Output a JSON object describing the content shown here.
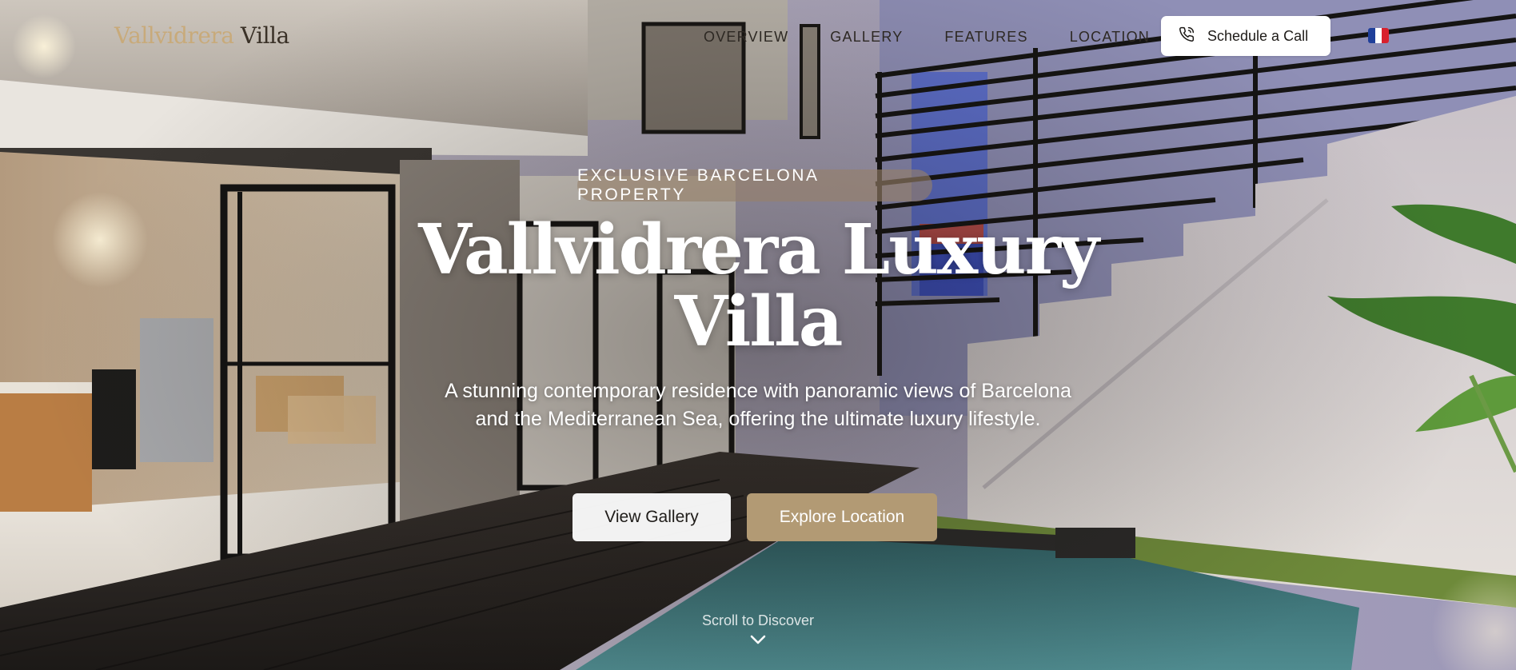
{
  "header": {
    "logo": {
      "part1": "Vallvidrera",
      "part2": "Villa"
    },
    "nav": [
      {
        "label": "OVERVIEW"
      },
      {
        "label": "GALLERY"
      },
      {
        "label": "FEATURES"
      },
      {
        "label": "LOCATION"
      }
    ],
    "cta": {
      "label": "Schedule a Call",
      "icon": "phone-icon"
    },
    "language": {
      "icon": "flag-france-icon",
      "colors": [
        "#1f3f9a",
        "#ffffff",
        "#d8212d"
      ]
    }
  },
  "hero": {
    "badge": "EXCLUSIVE BARCELONA PROPERTY",
    "title_line1": "Vallvidrera Luxury",
    "title_line2": "Villa",
    "subtitle": "A stunning contemporary residence with panoramic views of Barcelona and the Mediterranean Sea, offering the ultimate luxury lifestyle.",
    "buttons": [
      {
        "label": "View Gallery"
      },
      {
        "label": "Explore Location"
      }
    ],
    "scroll_hint": {
      "label": "Scroll to Discover",
      "icon": "chevron-down-icon"
    }
  },
  "colors": {
    "accent_gold": "#b29a74",
    "logo_gold": "#c8aa7a",
    "text_dark": "#2d2823",
    "white": "#ffffff"
  }
}
